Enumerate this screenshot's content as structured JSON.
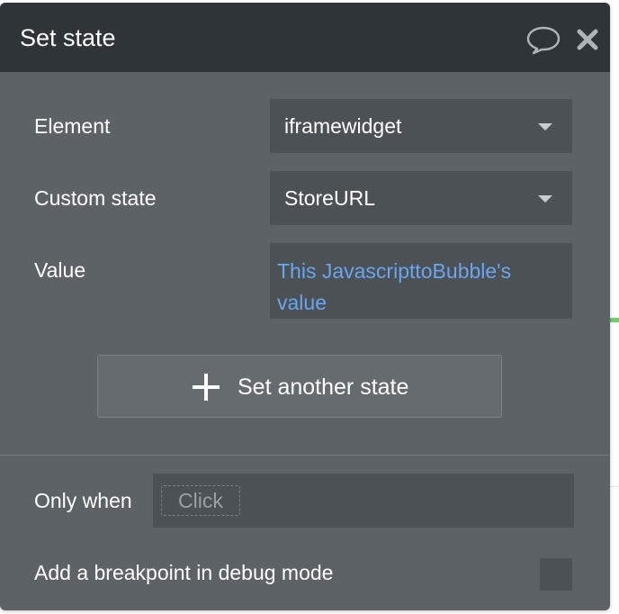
{
  "window": {
    "title": "Set state"
  },
  "header": {
    "comment_icon": "speech-bubble-icon",
    "close_icon": "close-x-icon"
  },
  "fields": {
    "element": {
      "label": "Element",
      "value": "iframewidget"
    },
    "custom_state": {
      "label": "Custom state",
      "value": "StoreURL"
    },
    "value": {
      "label": "Value",
      "expression": "This JavascripttoBubble's value"
    }
  },
  "actions": {
    "add_label": "Set another state",
    "add_icon": "plus-icon"
  },
  "condition": {
    "label": "Only when",
    "placeholder": "Click"
  },
  "breakpoint": {
    "label": "Add a breakpoint in debug mode",
    "checked": false
  },
  "colors": {
    "header_bg": "#2e3438",
    "panel_bg": "#5d6266",
    "field_bg": "#4c5155",
    "expression_text": "#6aa5ee"
  }
}
